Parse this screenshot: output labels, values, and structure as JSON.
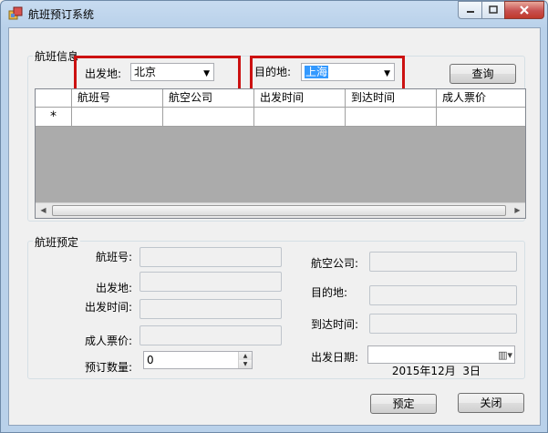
{
  "window": {
    "title": "航班预订系统",
    "icons": {
      "app": "app-window-icon",
      "minimize": "minimize-icon",
      "maximize": "maximize-icon",
      "close": "close-icon"
    }
  },
  "search": {
    "group_label": "航班信息",
    "from_label": "出发地:",
    "from_value": "北京",
    "to_label": "目的地:",
    "to_value": "上海",
    "query_button": "查询",
    "highlight_color": "#cc1111"
  },
  "grid": {
    "columns": [
      "航班号",
      "航空公司",
      "出发时间",
      "到达时间",
      "成人票价"
    ],
    "new_row_marker": "*",
    "scroll_left": "◀",
    "scroll_right": "▶"
  },
  "booking": {
    "group_label": "航班预定",
    "flight_no_label": "航班号:",
    "airline_label": "航空公司:",
    "from_label": "出发地:",
    "to_label": "目的地:",
    "depart_time_label": "出发时间:",
    "arrive_time_label": "到达时间:",
    "price_label": "成人票价:",
    "quantity_label": "预订数量:",
    "quantity_value": "0",
    "date_label": "出发日期:",
    "date_value": "2015年12月  3日"
  },
  "actions": {
    "book_button": "预定",
    "close_button": "关闭"
  }
}
